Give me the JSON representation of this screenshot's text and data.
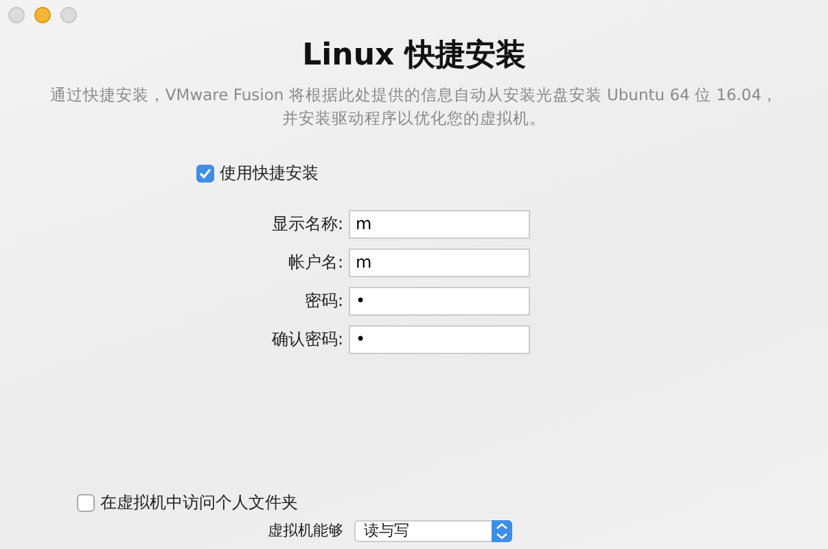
{
  "window": {
    "buttons": [
      {
        "enabled": false
      },
      {
        "enabled": true
      },
      {
        "enabled": false
      }
    ]
  },
  "title": "Linux 快捷安装",
  "description": "通过快捷安装，VMware Fusion 将根据此处提供的信息自动从安装光盘安装 Ubuntu 64 位 16.04，并安装驱动程序以优化您的虚拟机。",
  "easy_install": {
    "label": "使用快捷安装",
    "checked": true
  },
  "fields": [
    {
      "label": "显示名称:",
      "value": "m"
    },
    {
      "label": "帐户名:",
      "value": "m"
    },
    {
      "label": "密码:",
      "value": "•"
    },
    {
      "label": "确认密码:",
      "value": "•"
    }
  ],
  "share_folder": {
    "label": "在虚拟机中访问个人文件夹",
    "checked": false
  },
  "access": {
    "label": "虚拟机能够",
    "value": "读与写"
  }
}
